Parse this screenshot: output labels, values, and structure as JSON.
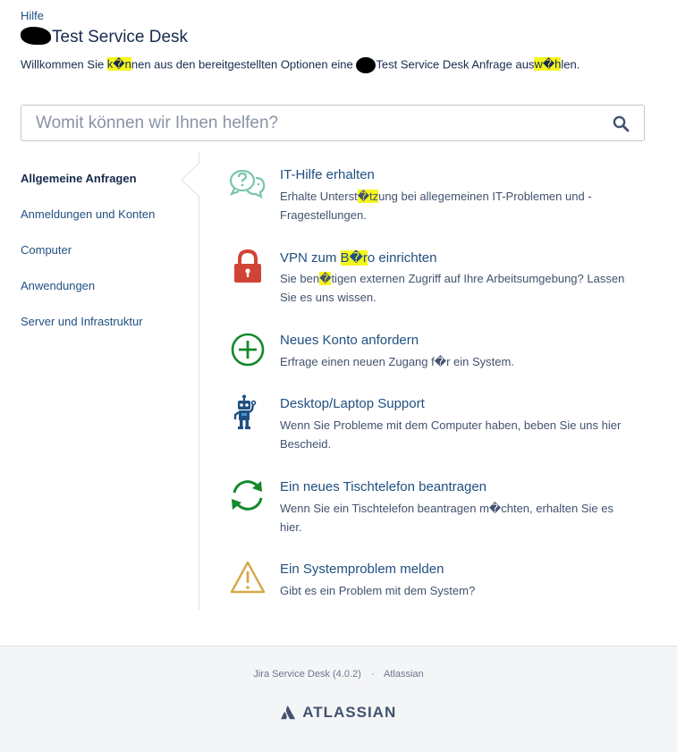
{
  "breadcrumb": "Hilfe",
  "header": {
    "title": "Test Service Desk",
    "welcome": {
      "p1": "Willkommen Sie ",
      "p2": "k",
      "p3": "�n",
      "p4": "nen aus den bereitgestellten Optionen eine",
      "p5": "Test Service Desk Anfrage aus",
      "p6": "w�h",
      "p7": "len."
    }
  },
  "search": {
    "placeholder": "Womit können wir Ihnen helfen?"
  },
  "sidebar": {
    "items": [
      {
        "label": "Allgemeine Anfragen"
      },
      {
        "label": "Anmeldungen und Konten"
      },
      {
        "label": "Computer"
      },
      {
        "label": "Anwendungen"
      },
      {
        "label": "Server und Infrastruktur"
      }
    ]
  },
  "requests": [
    {
      "icon": "question-bubbles-icon",
      "title": "IT-Hilfe erhalten",
      "desc": {
        "a": "Erhalte Unterst",
        "b": "�tz",
        "c": "ung bei allegemeinen IT-Problemen und -Fragestellungen."
      }
    },
    {
      "icon": "lock-icon",
      "title": {
        "a": "VPN zum ",
        "b": "B�r",
        "c": "o einrichten"
      },
      "desc": {
        "a": "Sie ben",
        "b": "�",
        "c": "tigen externen Zugriff auf Ihre Arbeitsumgebung? Lassen Sie es uns wissen."
      }
    },
    {
      "icon": "plus-circle-icon",
      "title": "Neues Konto anfordern",
      "desc": "Erfrage einen neuen Zugang f�r ein System."
    },
    {
      "icon": "robot-icon",
      "title": "Desktop/Laptop Support",
      "desc": "Wenn Sie Probleme mit dem Computer haben, beben Sie uns hier Bescheid."
    },
    {
      "icon": "refresh-icon",
      "title": "Ein neues Tischtelefon beantragen",
      "desc": "Wenn Sie ein Tischtelefon beantragen m�chten, erhalten Sie es hier."
    },
    {
      "icon": "warning-icon",
      "title": "Ein Systemproblem melden",
      "desc": "Gibt es ein Problem mit dem System?"
    }
  ],
  "footer": {
    "product": "Jira Service Desk (4.0.2)",
    "separator": "·",
    "vendor": "Atlassian",
    "logo_text": "ATLASSIAN"
  },
  "colors": {
    "link": "#205081",
    "highlight": "#f5f51e",
    "green": "#14892c",
    "red": "#d04437",
    "amber": "#d6a848",
    "teal": "#79c6a8"
  }
}
